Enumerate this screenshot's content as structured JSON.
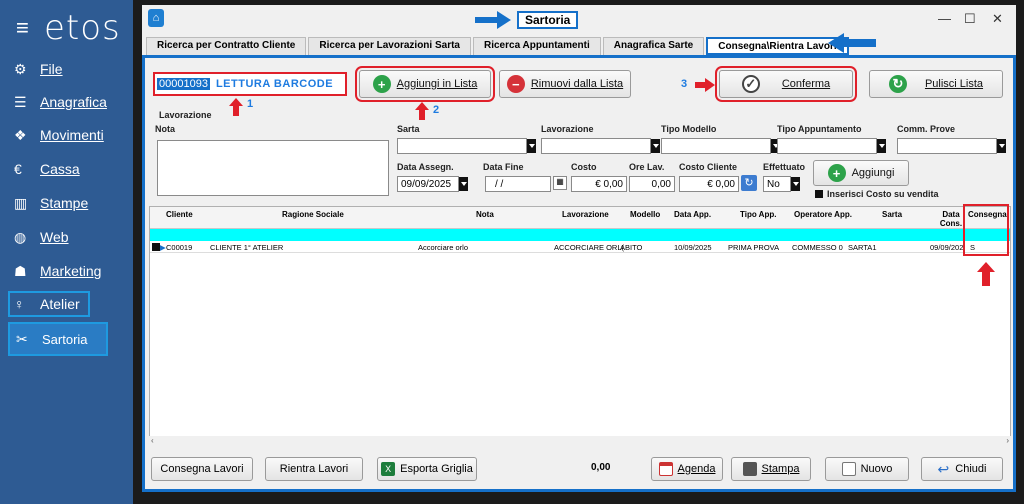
{
  "sidebar": {
    "logo": "etos",
    "items": [
      {
        "label": "File",
        "icon": "gear-icon"
      },
      {
        "label": "Anagrafica",
        "icon": "database-icon"
      },
      {
        "label": "Movimenti",
        "icon": "cubes-icon"
      },
      {
        "label": "Cassa",
        "icon": "euro-icon"
      },
      {
        "label": "Stampe",
        "icon": "bar-chart-icon"
      },
      {
        "label": "Web",
        "icon": "globe-icon"
      },
      {
        "label": "Marketing",
        "icon": "users-icon"
      },
      {
        "label": "Atelier",
        "icon": "person-icon"
      },
      {
        "label": "Sartoria",
        "icon": "scissors-icon"
      }
    ]
  },
  "window": {
    "title": "Sartoria",
    "tabs": [
      "Ricerca per Contratto Cliente",
      "Ricerca per Lavorazioni Sarta",
      "Ricerca Appuntamenti",
      "Anagrafica Sarte",
      "Consegna\\Rientra Lavori"
    ],
    "active_tab": 4
  },
  "toolbar": {
    "barcode_value": "00001093",
    "barcode_hint": "LETTURA BARCODE",
    "add_label": "Aggiungi in Lista",
    "remove_label": "Rimuovi dalla Lista",
    "confirm_label": "Conferma",
    "clear_label": "Pulisci Lista",
    "marker_1": "1",
    "marker_2": "2",
    "marker_3": "3"
  },
  "form": {
    "section_label": "Lavorazione",
    "nota_label": "Nota",
    "sarta_label": "Sarta",
    "lavorazione_label": "Lavorazione",
    "tipo_modello_label": "Tipo Modello",
    "tipo_appuntamento_label": "Tipo Appuntamento",
    "comm_prove_label": "Comm. Prove",
    "data_assegn_label": "Data Assegn.",
    "data_assegn_value": "09/09/2025",
    "data_fine_label": "Data Fine",
    "data_fine_value": "/ /",
    "costo_label": "Costo",
    "costo_value": "€ 0,00",
    "ore_lav_label": "Ore Lav.",
    "ore_lav_value": "0,00",
    "costo_cliente_label": "Costo Cliente",
    "costo_cliente_value": "€ 0,00",
    "effettuato_label": "Effettuato",
    "effettuato_value": "No",
    "aggiungi_label": "Aggiungi",
    "inserisci_costo_label": "Inserisci Costo su vendita"
  },
  "grid": {
    "columns": [
      "Cliente",
      "Ragione Sociale",
      "Nota",
      "Lavorazione",
      "Modello",
      "Data App.",
      "Tipo App.",
      "Operatore App.",
      "Sarta",
      "Data Cons.",
      "Consegna"
    ],
    "rows": [
      [
        "C00019",
        "CLIENTE 1° ATELIER",
        "Accorciare orlo",
        "ACCORCIARE ORL(",
        "ABITO",
        "10/09/2025",
        "PRIMA PROVA",
        "COMMESSO 0",
        "SARTA1",
        "09/09/202",
        "S"
      ]
    ]
  },
  "footer": {
    "consegna_label": "Consegna Lavori",
    "rientra_label": "Rientra Lavori",
    "esporta_label": "Esporta Griglia",
    "total": "0,00",
    "agenda_label": "Agenda",
    "stampa_label": "Stampa",
    "nuovo_label": "Nuovo",
    "chiudi_label": "Chiudi"
  },
  "colors": {
    "sidebar_bg": "#2e5b93",
    "accent_blue": "#1570c9",
    "highlight_red": "#e0202a",
    "filter_cyan": "#00ffff"
  }
}
